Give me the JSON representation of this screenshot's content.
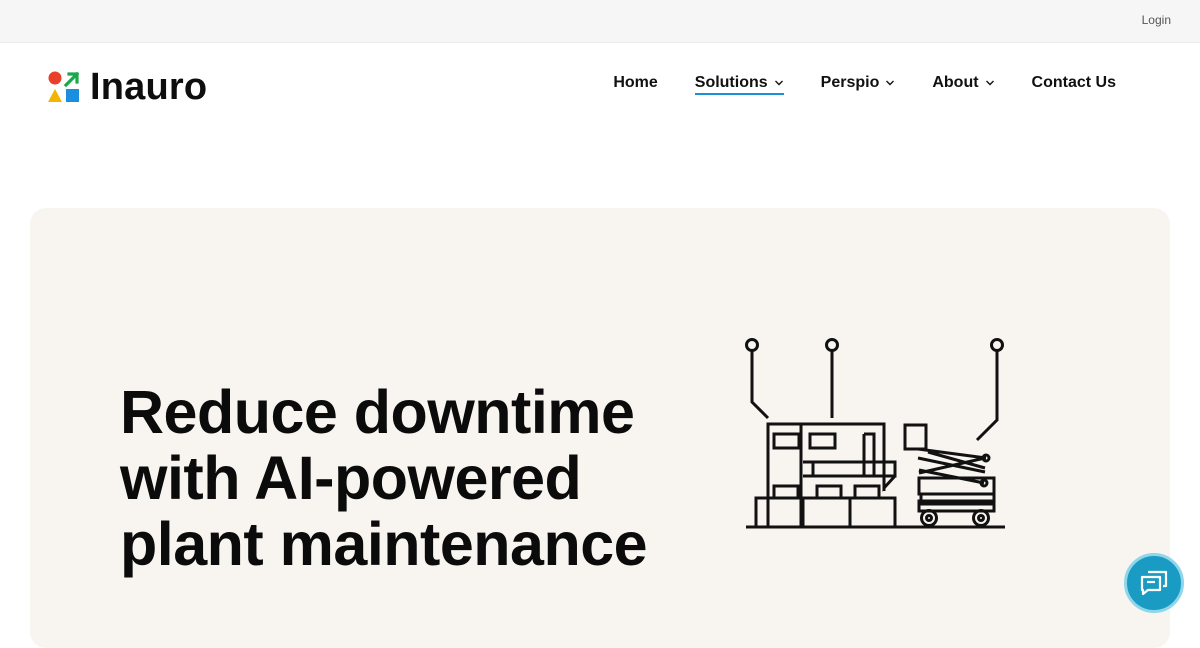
{
  "topbar": {
    "login_label": "Login"
  },
  "header": {
    "logo_text": "Inauro",
    "nav": [
      {
        "label": "Home",
        "has_dropdown": false,
        "active": false
      },
      {
        "label": "Solutions",
        "has_dropdown": true,
        "active": true
      },
      {
        "label": "Perspio",
        "has_dropdown": true,
        "active": false
      },
      {
        "label": "About",
        "has_dropdown": true,
        "active": false
      },
      {
        "label": "Contact Us",
        "has_dropdown": false,
        "active": false
      }
    ]
  },
  "hero": {
    "headline_line1": "Reduce downtime",
    "headline_line2": "with AI-powered",
    "headline_line3": "plant maintenance",
    "illustration_icon": "industrial-plant-sensors-illustration"
  },
  "chat": {
    "icon": "chat-bubbles-icon"
  },
  "colors": {
    "accent": "#1a8fd6",
    "hero_bg": "#f8f4f0",
    "chat_button": "#1a9bc4",
    "logo_red": "#e8402a",
    "logo_green": "#1aa84a",
    "logo_yellow": "#f5b400",
    "logo_blue": "#1a8fe0"
  }
}
